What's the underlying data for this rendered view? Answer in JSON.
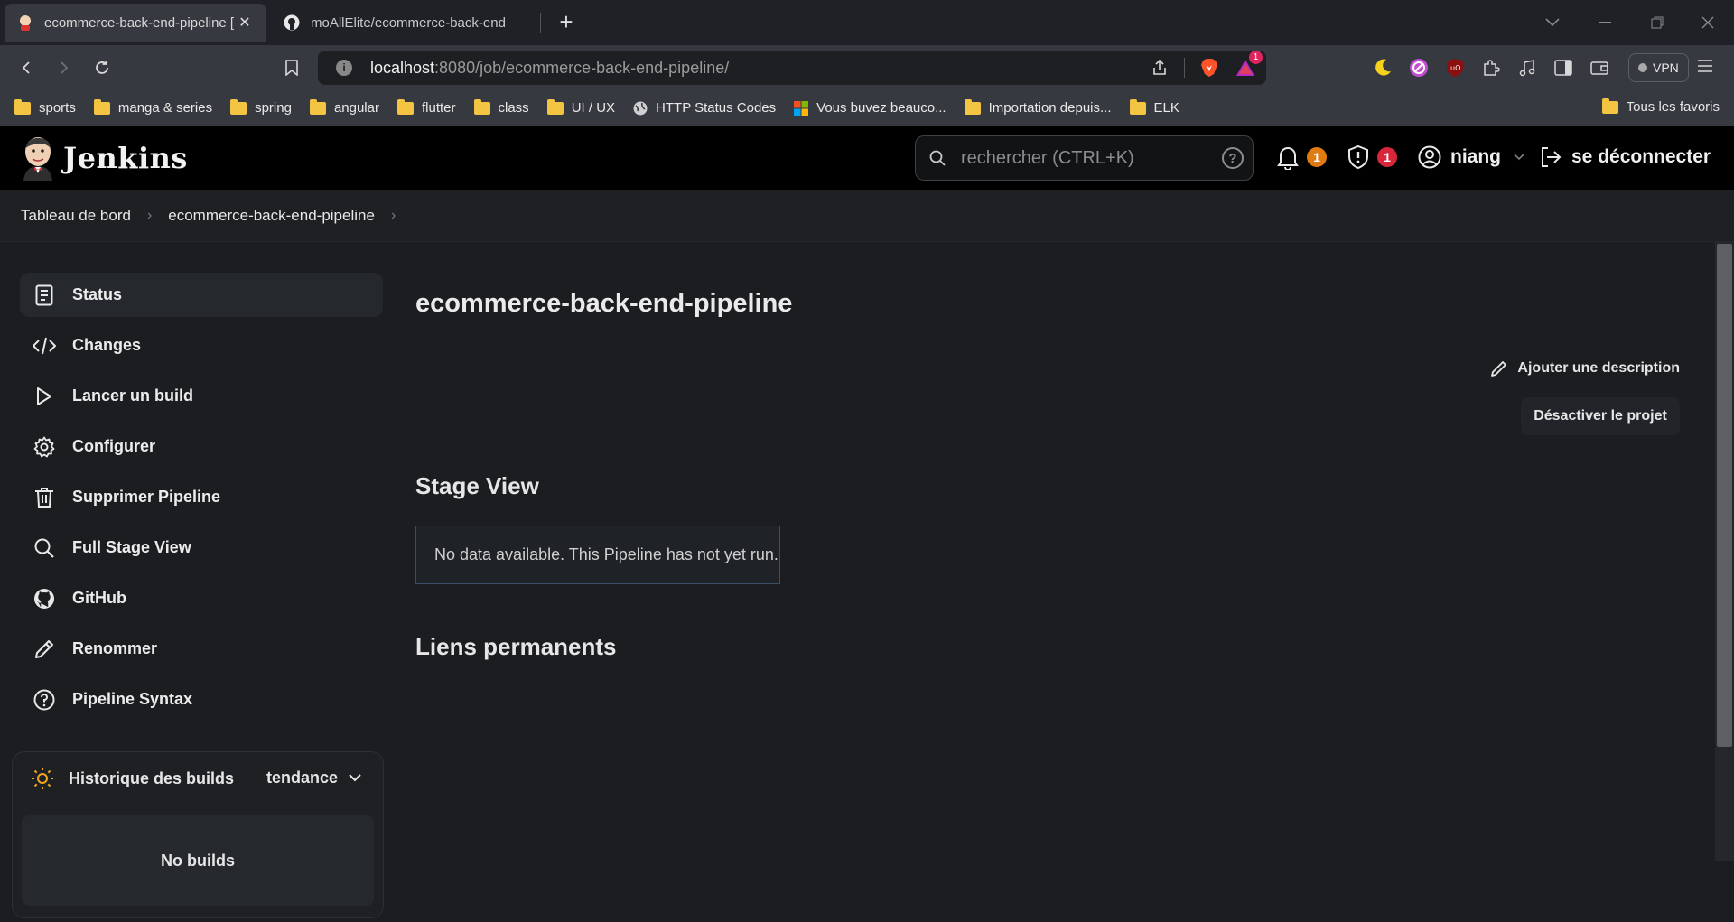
{
  "browser": {
    "tabs": [
      {
        "title": "ecommerce-back-end-pipeline [",
        "active": true
      },
      {
        "title": "moAllElite/ecommerce-back-end",
        "active": false
      }
    ],
    "url_host": "localhost",
    "url_path": ":8080/job/ecommerce-back-end-pipeline/",
    "brave_alert_count": "1",
    "vpn_label": "VPN",
    "bookmarks": [
      "sports",
      "manga & series",
      "spring",
      "angular",
      "flutter",
      "class",
      "UI / UX",
      "HTTP Status Codes",
      "Vous buvez beauco...",
      "Importation depuis...",
      "ELK"
    ],
    "all_bookmarks_label": "Tous les favoris"
  },
  "jenkins": {
    "logo_text": "Jenkins",
    "search_placeholder": "rechercher (CTRL+K)",
    "notifications_count": "1",
    "security_count": "1",
    "username": "niang",
    "logout_label": "se déconnecter",
    "breadcrumbs": [
      "Tableau de bord",
      "ecommerce-back-end-pipeline"
    ],
    "sidebar": [
      {
        "label": "Status",
        "icon": "document-icon",
        "active": true
      },
      {
        "label": "Changes",
        "icon": "code-icon"
      },
      {
        "label": "Lancer un build",
        "icon": "play-icon"
      },
      {
        "label": "Configurer",
        "icon": "gear-icon"
      },
      {
        "label": "Supprimer Pipeline",
        "icon": "trash-icon"
      },
      {
        "label": "Full Stage View",
        "icon": "search-icon"
      },
      {
        "label": "GitHub",
        "icon": "github-icon"
      },
      {
        "label": "Renommer",
        "icon": "pencil-icon"
      },
      {
        "label": "Pipeline Syntax",
        "icon": "help-icon"
      }
    ],
    "build_history": {
      "title": "Historique des builds",
      "trend_label": "tendance",
      "empty_label": "No builds"
    },
    "page_title": "ecommerce-back-end-pipeline",
    "add_description_label": "Ajouter une description",
    "disable_project_label": "Désactiver le projet",
    "stage_view_title": "Stage View",
    "stage_view_empty": "No data available. This Pipeline has not yet run.",
    "permalinks_title": "Liens permanents"
  },
  "colors": {
    "accent_orange": "#e07b12",
    "alert_red": "#d9263b",
    "folder_yellow": "#f3c442"
  }
}
